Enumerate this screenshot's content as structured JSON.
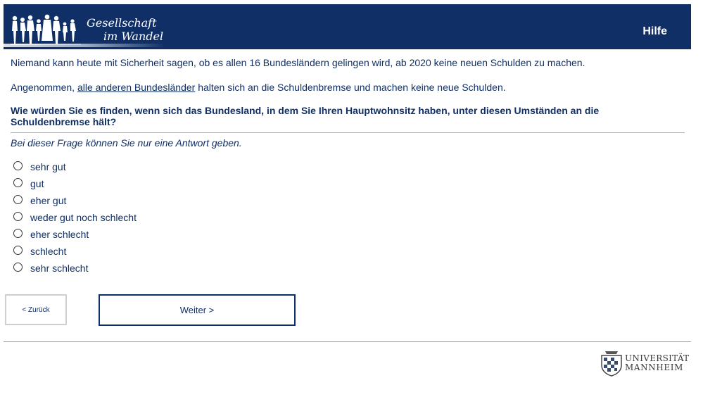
{
  "header": {
    "logo_line1": "Gesellschaft",
    "logo_line2": "im Wandel",
    "help_label": "Hilfe",
    "background_color": "#0f2f66"
  },
  "intro": {
    "line1": "Niemand kann heute mit Sicherheit sagen, ob es allen 16 Bundesländern gelingen wird, ab 2020 keine neuen Schulden zu machen.",
    "line2_pre": "Angenommen, ",
    "line2_link": "alle anderen Bundesländer",
    "line2_post": " halten sich an die Schuldenbremse und machen keine neue Schulden."
  },
  "question": {
    "text": "Wie würden Sie es finden, wenn sich das Bundesland, in dem Sie Ihren Hauptwohnsitz haben, unter diesen Umständen an die Schuldenbremse hält?",
    "instruction": "Bei dieser Frage können Sie nur eine Antwort geben."
  },
  "options": [
    {
      "label": "sehr gut",
      "selected": false
    },
    {
      "label": "gut",
      "selected": false
    },
    {
      "label": "eher gut",
      "selected": false
    },
    {
      "label": "weder gut noch schlecht",
      "selected": false
    },
    {
      "label": "eher schlecht",
      "selected": false
    },
    {
      "label": "schlecht",
      "selected": false
    },
    {
      "label": "sehr schlecht",
      "selected": false
    }
  ],
  "navigation": {
    "back_label": "< Zurück",
    "next_label": "Weiter >"
  },
  "footer": {
    "uni_line1": "UNIVERSITÄT",
    "uni_line2": "MANNHEIM"
  }
}
